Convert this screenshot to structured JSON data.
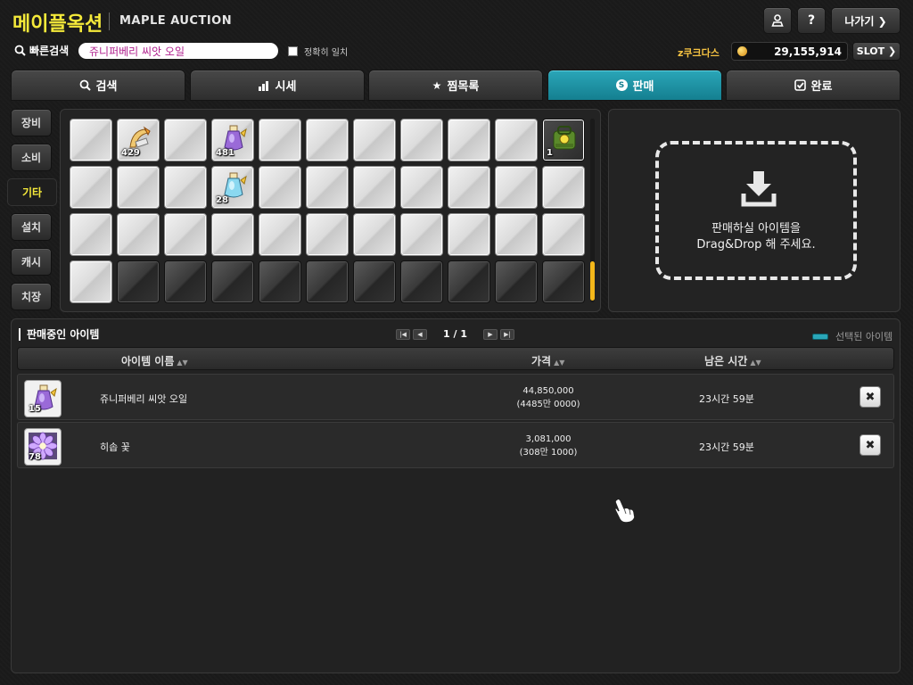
{
  "header": {
    "brand_ko": "메이플옥션",
    "brand_en": "MAPLE AUCTION",
    "user_icon": "user-icon",
    "help_label": "?",
    "exit_label": "나가기 ❯"
  },
  "quick_search": {
    "label": "빠른검색",
    "value": "쥬니퍼베리 씨앗 오일",
    "exact_label": "정확히 일치",
    "exact_checked": false
  },
  "currency": {
    "label": "z쿠크다스",
    "value": "29,155,914",
    "slot_label": "SLOT ❯",
    "coin_color": "#f3a623"
  },
  "tabs": [
    {
      "label": "검색",
      "icon": "search-icon",
      "active": false
    },
    {
      "label": "시세",
      "icon": "bar-chart-icon",
      "active": false
    },
    {
      "label": "찜목록",
      "icon": "star-icon",
      "active": false
    },
    {
      "label": "판매",
      "icon": "coin-s-icon",
      "active": true
    },
    {
      "label": "완료",
      "icon": "check-box-icon",
      "active": false
    }
  ],
  "categories": [
    {
      "label": "장비",
      "active": false
    },
    {
      "label": "소비",
      "active": false
    },
    {
      "label": "기타",
      "active": true
    },
    {
      "label": "설치",
      "active": false
    },
    {
      "label": "캐시",
      "active": false
    },
    {
      "label": "치장",
      "active": false
    }
  ],
  "inventory": {
    "items": [
      {
        "slot": 1,
        "qty": "429",
        "icon": "horn-item-icon"
      },
      {
        "slot": 3,
        "qty": "481",
        "icon": "purple-potion-icon"
      },
      {
        "slot": 10,
        "qty": "1",
        "icon": "green-bag-icon"
      },
      {
        "slot": 14,
        "qty": "28",
        "icon": "blue-potion-icon"
      }
    ]
  },
  "drop_zone": {
    "line1": "판매하실 아이템을",
    "line2": "Drag&Drop 해 주세요."
  },
  "selling": {
    "title": "판매중인 아이템",
    "page": "1 / 1",
    "legend_label": "선택된 아이템",
    "legend_color": "#2aa6b8",
    "columns": {
      "name": "아이템 이름",
      "price": "가격",
      "time": "남은 시간"
    },
    "rows": [
      {
        "qty": "15",
        "icon": "purple-potion-icon",
        "name": "쥬니퍼베리 씨앗 오일",
        "price": "44,850,000",
        "price_sub": "(4485만 0000)",
        "time": "23시간 59분"
      },
      {
        "qty": "78",
        "icon": "purple-flower-icon",
        "name": "히솝 꽃",
        "price": "3,081,000",
        "price_sub": "(308만 1000)",
        "time": "23시간 59분"
      }
    ]
  }
}
